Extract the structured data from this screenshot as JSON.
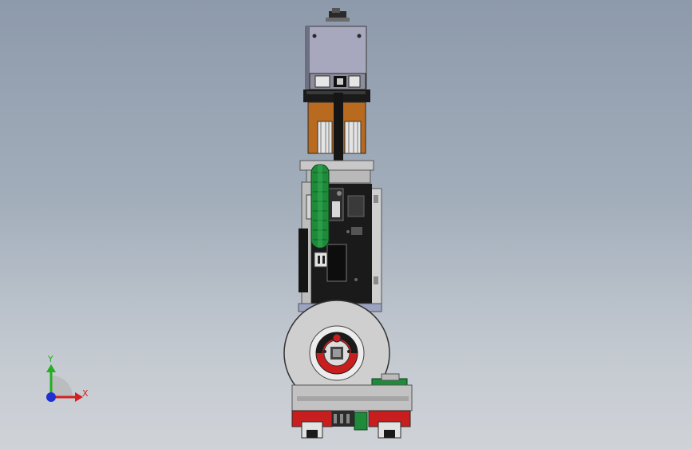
{
  "viewport": {
    "background_top": "#8d9aab",
    "background_bottom": "#cfd3d8"
  },
  "triad": {
    "x_label": "X",
    "y_label": "Y",
    "x_color": "#d42020",
    "y_color": "#20b020",
    "z_color": "#2030d0"
  },
  "model": {
    "accent_colors": {
      "motor_housing": "#a7a8bd",
      "copper_bracket": "#b86a1e",
      "green_gear": "#1f8a3a",
      "red_rail_block": "#c81e1e",
      "frame_gray": "#c8c8c8",
      "dark_body": "#1a1a1a"
    }
  }
}
